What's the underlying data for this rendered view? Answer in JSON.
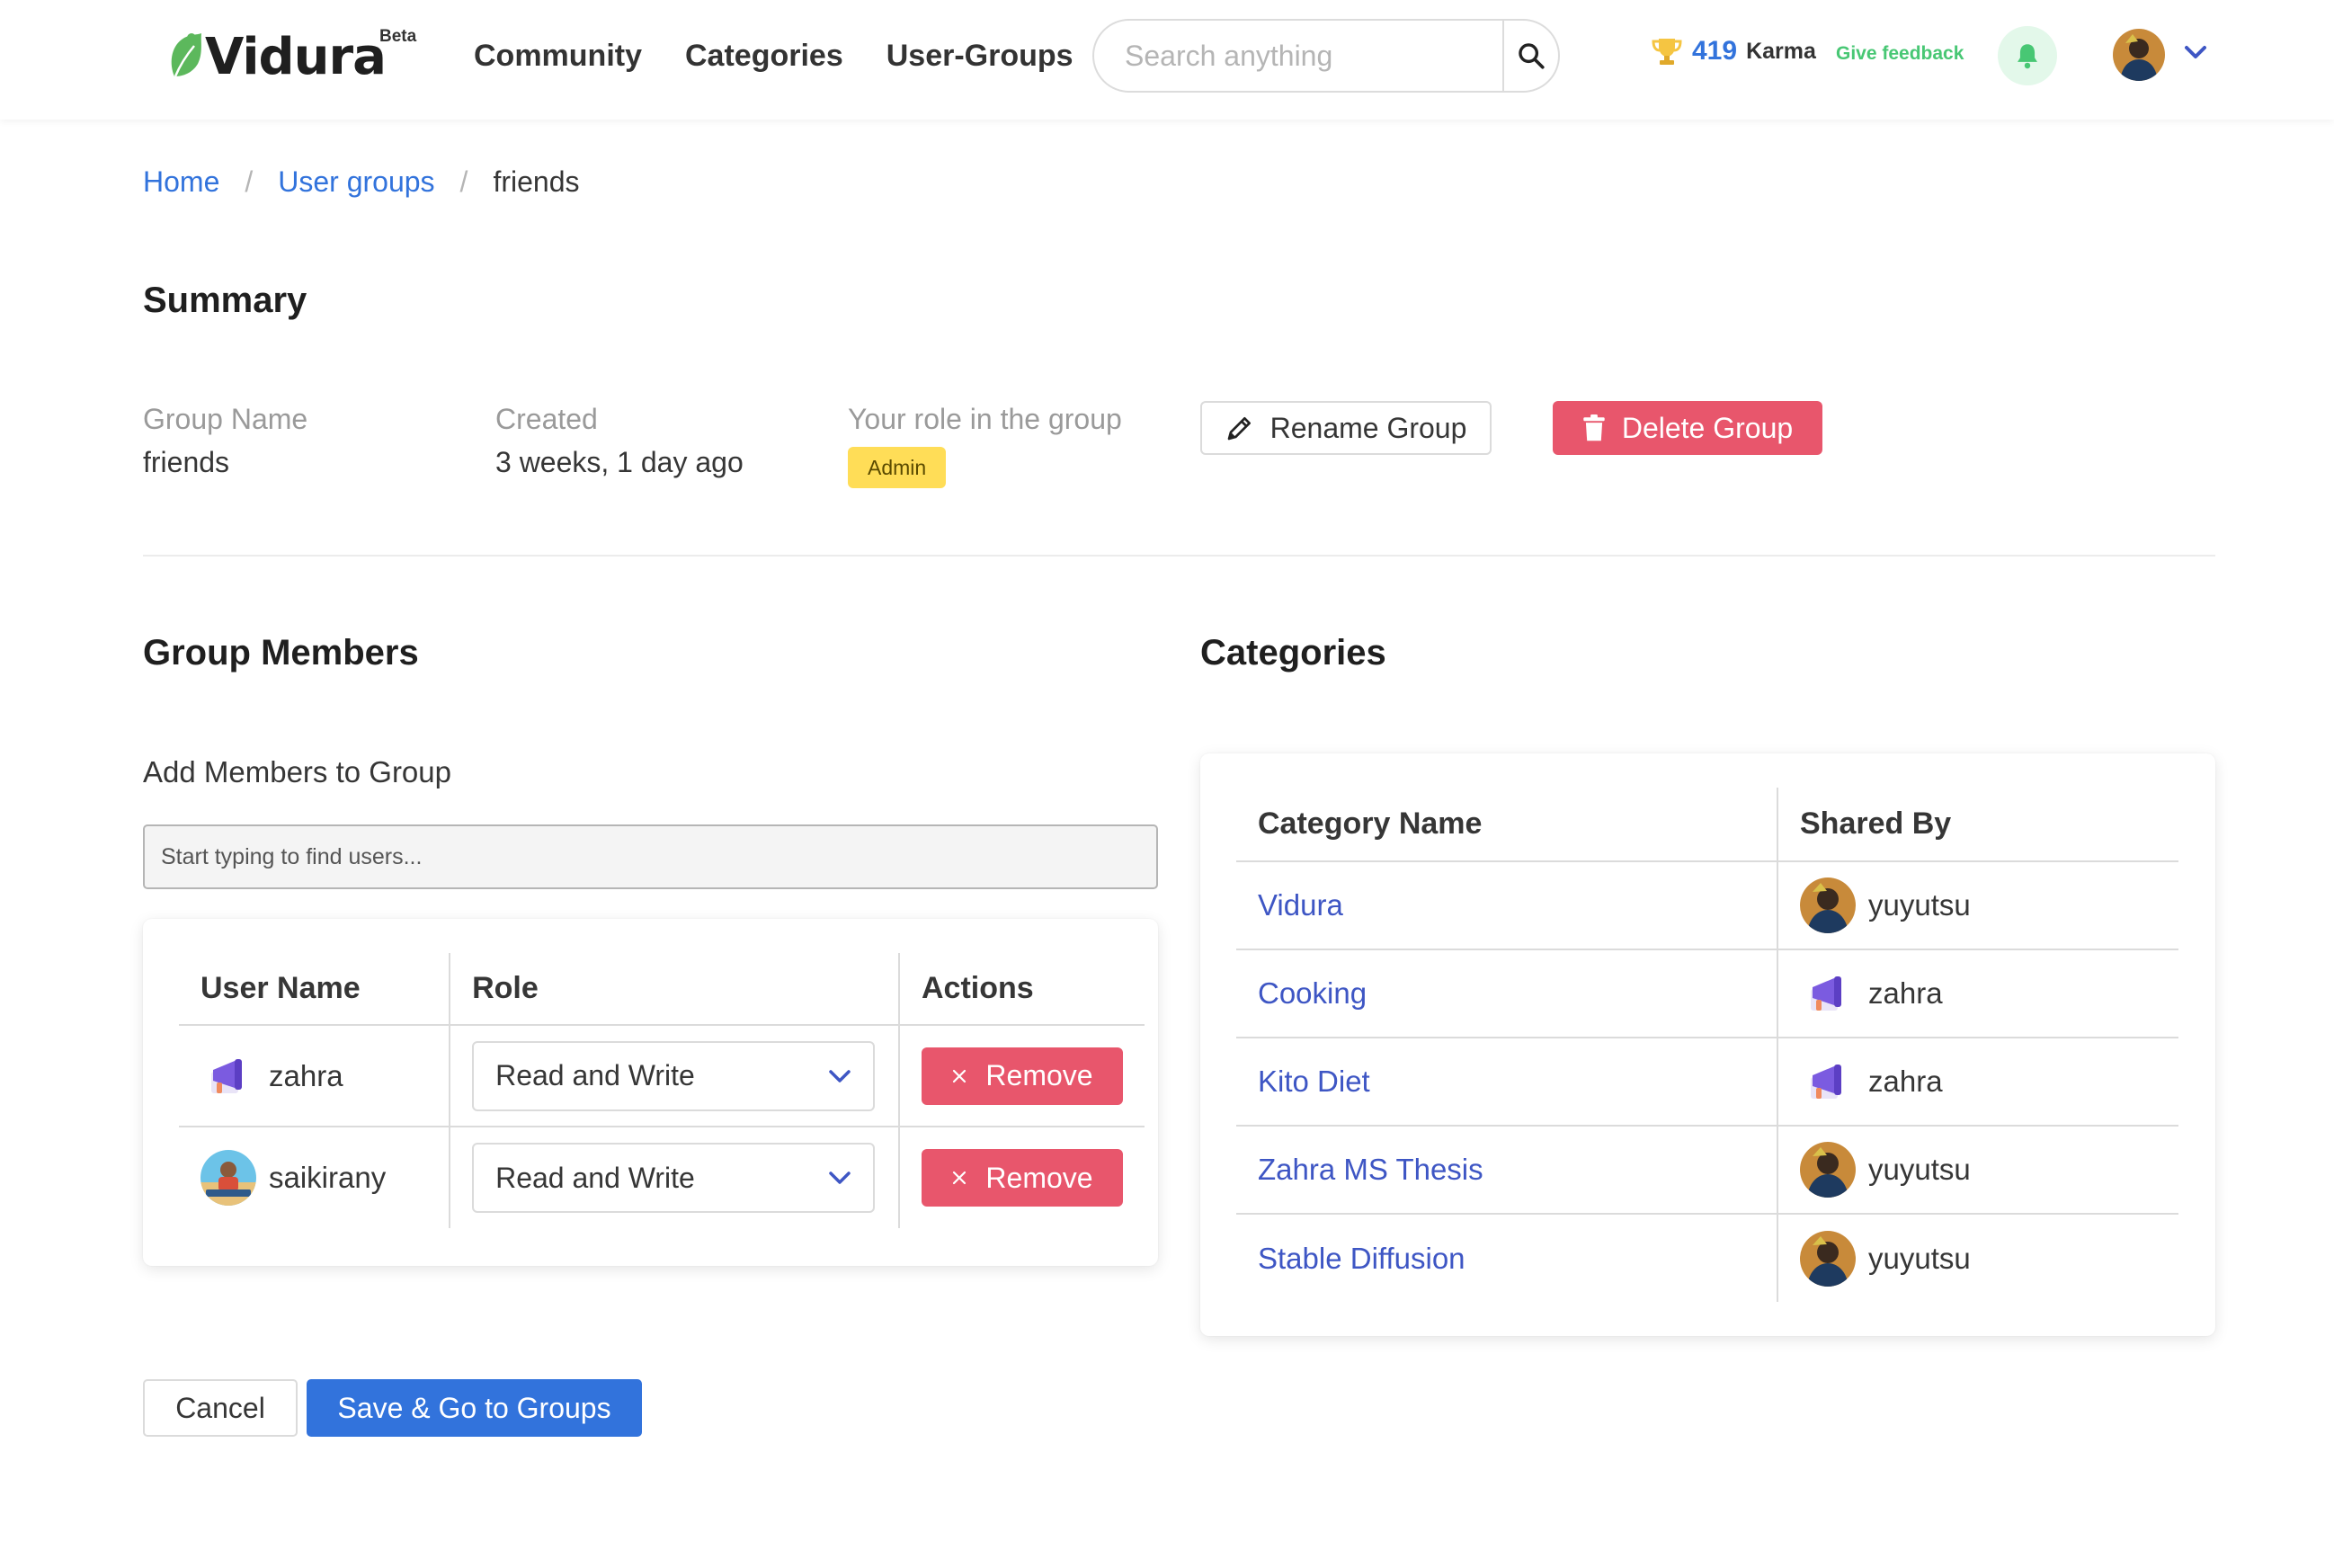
{
  "header": {
    "logo_text": "Vidura",
    "logo_badge": "Beta",
    "nav": [
      "Community",
      "Categories",
      "User-Groups"
    ],
    "search_placeholder": "Search anything",
    "karma_value": "419",
    "karma_label": "Karma",
    "feedback_label": "Give feedback"
  },
  "breadcrumb": {
    "home": "Home",
    "user_groups": "User groups",
    "current": "friends",
    "separator": "/"
  },
  "summary": {
    "heading": "Summary",
    "group_name_label": "Group Name",
    "group_name": "friends",
    "created_label": "Created",
    "created": "3 weeks, 1 day ago",
    "role_label": "Your role in the group",
    "role": "Admin",
    "rename_label": "Rename Group",
    "delete_label": "Delete Group"
  },
  "members": {
    "heading": "Group Members",
    "add_label": "Add Members to Group",
    "search_placeholder": "Start typing to find users...",
    "columns": [
      "User Name",
      "Role",
      "Actions"
    ],
    "rows": [
      {
        "user": "zahra",
        "role": "Read and Write",
        "action": "Remove"
      },
      {
        "user": "saikirany",
        "role": "Read and Write",
        "action": "Remove"
      }
    ]
  },
  "categories": {
    "heading": "Categories",
    "columns": [
      "Category Name",
      "Shared By"
    ],
    "rows": [
      {
        "name": "Vidura",
        "shared_by": "yuyutsu"
      },
      {
        "name": "Cooking",
        "shared_by": "zahra"
      },
      {
        "name": "Kito Diet",
        "shared_by": "zahra"
      },
      {
        "name": "Zahra MS Thesis",
        "shared_by": "yuyutsu"
      },
      {
        "name": "Stable Diffusion",
        "shared_by": "yuyutsu"
      }
    ]
  },
  "footer": {
    "cancel_label": "Cancel",
    "save_label": "Save & Go to Groups"
  },
  "colors": {
    "primary": "#3273dc",
    "danger": "#e8566c",
    "success": "#48c774",
    "warning": "#ffdd57",
    "link": "#3e56c4"
  }
}
